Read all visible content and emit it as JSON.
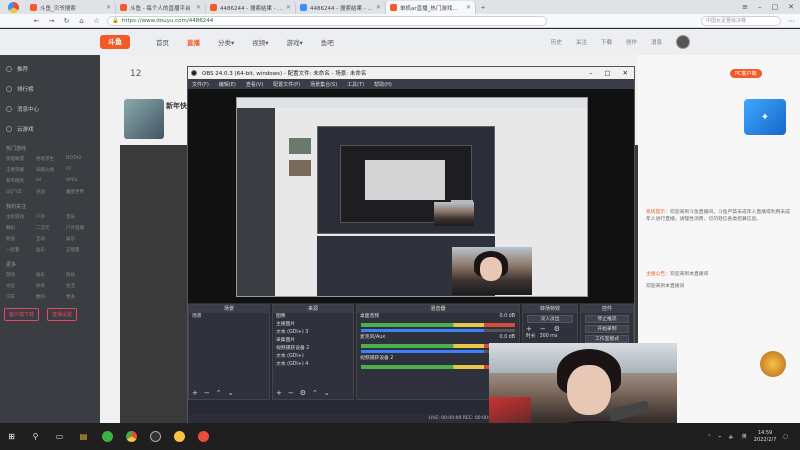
{
  "browser": {
    "tabs": [
      {
        "title": "斗鱼_贝爷搜索",
        "color": "#f45a27"
      },
      {
        "title": "斗鱼 - 每个人的直播平台",
        "color": "#f45a27"
      },
      {
        "title": "4486244 - 搜索结果 - 斗鱼",
        "color": "#f45a27"
      },
      {
        "title": "4486244 - 搜索结果 - 斗鱼",
        "color": "#3d8ef7"
      },
      {
        "title": "单机ar直播_热门游戏直播_斗鱼",
        "color": "#f45a27"
      }
    ],
    "new_tab": "+",
    "address": "https://www.douyu.com/4486244",
    "search_placeholder": "中国女足晋级决赛",
    "login_badge": "已登录"
  },
  "site": {
    "logo": "斗鱼",
    "nav": [
      "首页",
      "直播",
      "分类▾",
      "视频▾",
      "游戏▾",
      "鱼吧"
    ],
    "header_right": [
      "历史",
      "关注",
      "下载",
      "创作",
      "消息"
    ],
    "room_count": "12",
    "room_title": "新年快",
    "pc_badge": "PC客户端"
  },
  "leftnav": {
    "items": [
      "推荐",
      "排行榜",
      "消息中心",
      "云游戏"
    ],
    "section_hot": "热门游戏",
    "hot_grid": [
      "英雄联盟",
      "绝地求生",
      "DOTA2",
      "王者荣耀",
      "穿越火线",
      "CF",
      "和平精英",
      "lol",
      "APEX",
      "QQ飞车",
      "逆战",
      "魔兽世界"
    ],
    "section_mine": "我的关注",
    "mine_grid": [
      "主机游戏",
      "户外",
      "音乐",
      "舞蹈",
      "二次元",
      "户外直播",
      "颜值",
      "互动",
      "娱乐",
      "一起看",
      "鱼乐",
      "正能量"
    ],
    "section_more": "更多",
    "more_grid": [
      "游戏",
      "娱乐",
      "科技",
      "文化",
      "体育",
      "生活",
      "汽车",
      "数码",
      "更多"
    ],
    "buttons": [
      "客户端下载",
      "直播设置"
    ]
  },
  "rightpanel": {
    "messages": [
      {
        "label": "系统提示：",
        "text": "欢迎来到斗鱼直播间，斗鱼严禁未成年人直播或利用未成年人进行直播，请理性消费，切勿轻信各类招募信息。"
      },
      {
        "label": "主播公告：",
        "text": "欢迎来到本直播间"
      },
      {
        "label": "",
        "text": "欢迎来到本直播间"
      }
    ]
  },
  "obs": {
    "title": "OBS 24.0.3 (64-bit, windows) - 配置文件: 未命名 - 场景: 未命名",
    "menu": [
      "文件(F)",
      "编辑(E)",
      "查看(V)",
      "配置文件(P)",
      "场景集合(S)",
      "工具(T)",
      "帮助(H)"
    ],
    "docks": {
      "scenes": {
        "header": "场景",
        "items": [
          "场景"
        ]
      },
      "sources": {
        "header": "来源",
        "items": [
          "图像",
          "主播图片",
          "文本 (GDI+) 3",
          "采集图片",
          "视频捕获设备 2",
          "文本 (GDI+)",
          "文本 (GDI+) 4"
        ]
      },
      "mixer": {
        "header": "混音器",
        "tracks": [
          {
            "name": "桌面音频",
            "db": "0.0 dB"
          },
          {
            "name": "麦克风/Aux",
            "db": "0.0 dB"
          },
          {
            "name": "视频捕获设备 2",
            "db": "0.0 dB"
          }
        ]
      },
      "transitions": {
        "header": "转场特效",
        "type": "淡入淡出",
        "duration_label": "时长",
        "duration": "300 ms"
      },
      "controls": {
        "header": "控件",
        "buttons": [
          "停止推流",
          "开始录制",
          "工作室模式",
          "设置",
          "退出"
        ]
      }
    },
    "status": "LIVE: 00:00:00    REC: 00:00:00    CPU: 1.9%, 30.00 fps"
  },
  "taskbar": {
    "time": "14:59",
    "date": "2022/2/7",
    "lang": "英"
  }
}
